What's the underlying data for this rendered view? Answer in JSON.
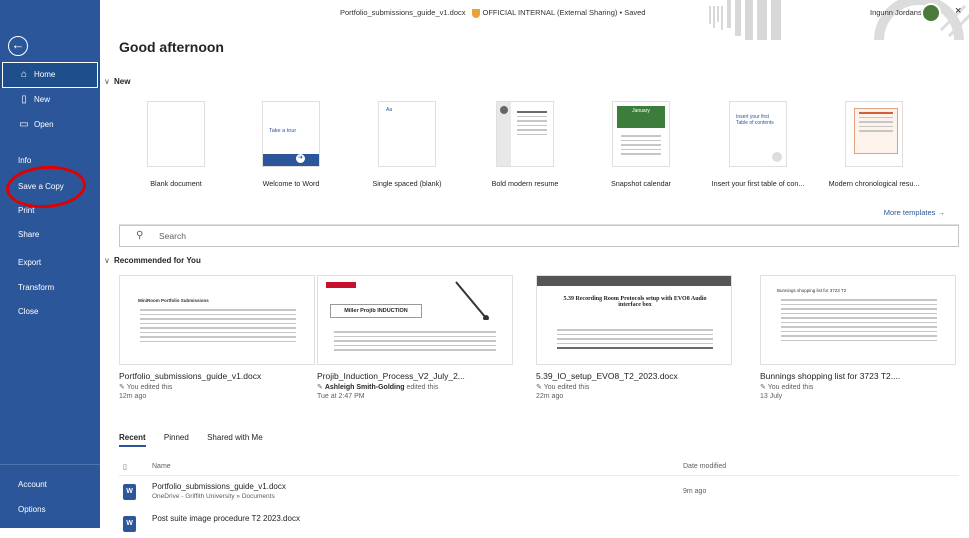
{
  "titlebar": {
    "doc_name": "Portfolio_submissions_guide_v1.docx",
    "label": "OFFICIAL INTERNAL (External Sharing) • Saved",
    "user": "Ingunn Jordansen",
    "help": "?",
    "minimize": "–",
    "close": "×"
  },
  "sidebar": {
    "back": "←",
    "items": [
      {
        "label": "Home",
        "icon": "home-icon"
      },
      {
        "label": "New",
        "icon": "new-doc-icon"
      },
      {
        "label": "Open",
        "icon": "folder-icon"
      },
      {
        "label": "Info"
      },
      {
        "label": "Save a Copy"
      },
      {
        "label": "Print"
      },
      {
        "label": "Share"
      },
      {
        "label": "Export"
      },
      {
        "label": "Transform"
      },
      {
        "label": "Close"
      }
    ],
    "bottom": [
      {
        "label": "Account"
      },
      {
        "label": "Options"
      }
    ],
    "accent": "#2b579a",
    "annotation_color": "#e00000"
  },
  "greeting": "Good afternoon",
  "new_section": {
    "heading": "New",
    "templates": [
      {
        "name": "Blank document"
      },
      {
        "name": "Welcome to Word",
        "thumb_text": "Take a tour"
      },
      {
        "name": "Single spaced (blank)",
        "thumb_text": "Aa"
      },
      {
        "name": "Bold modern resume"
      },
      {
        "name": "Snapshot calendar",
        "thumb_text": "January"
      },
      {
        "name": "Insert your first table of con...",
        "thumb_text": "Insert your first Table of contents"
      },
      {
        "name": "Modern chronological resu..."
      }
    ],
    "more_templates": "More templates →"
  },
  "search": {
    "placeholder": "Search"
  },
  "recommended": {
    "heading": "Recommended for You",
    "cards": [
      {
        "title": "Portfolio_submissions_guide_v1.docx",
        "activity_prefix": "",
        "activity_name": "",
        "activity": "You edited this",
        "time": "12m ago",
        "preview_heading": "MiniRoom Portfolio Submissions"
      },
      {
        "title": "Projib_Induction_Process_V2_July_2...",
        "activity_prefix": "",
        "activity_name": "Ashleigh Smith-Golding",
        "activity": " edited this",
        "time": "Tue at 2:47 PM",
        "preview_heading": "Miller Projib INDUCTION"
      },
      {
        "title": "5.39_IO_setup_EVO8_T2_2023.docx",
        "activity_prefix": "",
        "activity_name": "",
        "activity": "You edited this",
        "time": "22m ago",
        "preview_heading": "5.39 Recording Room Protocols setup with EVO8 Audio interface box"
      },
      {
        "title": "Bunnings shopping list for 3723 T2....",
        "activity_prefix": "",
        "activity_name": "",
        "activity": "You edited this",
        "time": "13 July",
        "preview_heading": "Bunnings shopping list for 3723 T2"
      }
    ]
  },
  "file_tabs": [
    "Recent",
    "Pinned",
    "Shared with Me"
  ],
  "file_list": {
    "col_name": "Name",
    "col_date": "Date modified",
    "rows": [
      {
        "name": "Portfolio_submissions_guide_v1.docx",
        "path": "OneDrive - Griffith University » Documents",
        "date": "9m ago"
      },
      {
        "name": "Post suite image procedure T2 2023.docx",
        "path": "",
        "date": ""
      }
    ]
  }
}
